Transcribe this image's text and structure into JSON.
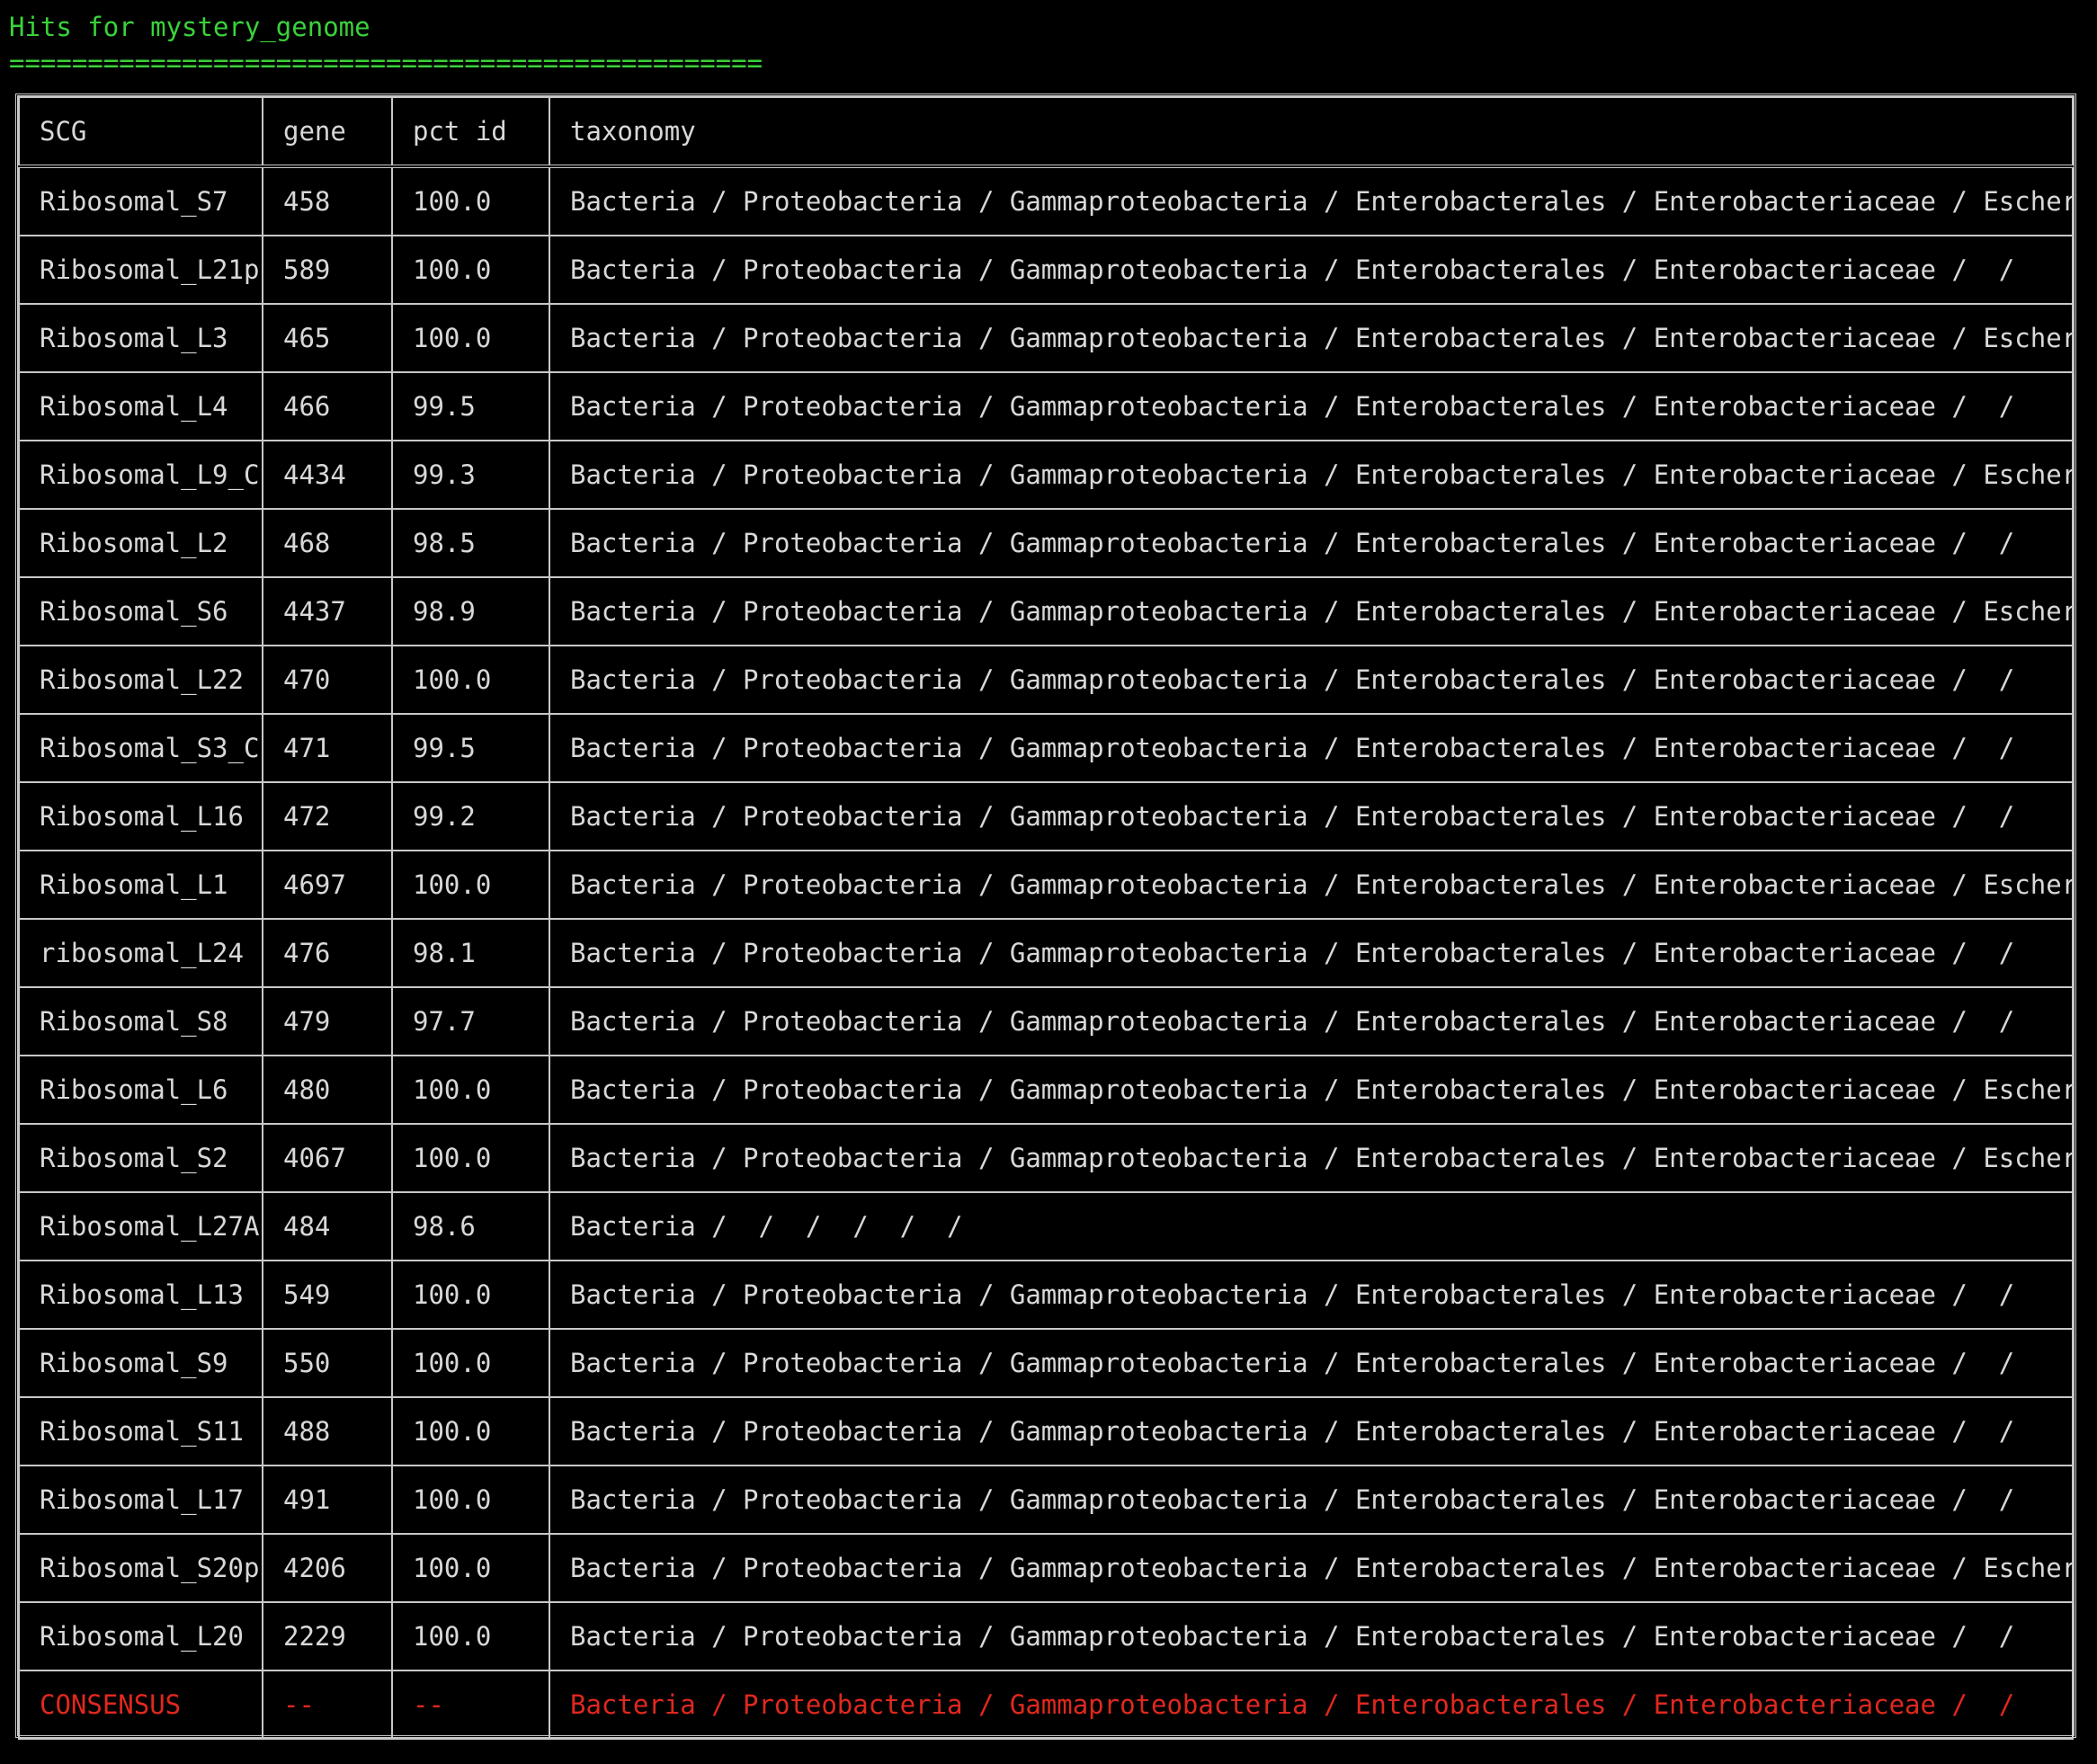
{
  "title": "Hits for mystery_genome",
  "rule": "================================================",
  "table": {
    "headers": [
      "SCG",
      "gene",
      "pct id",
      "taxonomy"
    ],
    "rows": [
      {
        "scg": "Ribosomal_S7",
        "gene": "458",
        "pct": "100.0",
        "taxonomy": "Bacteria / Proteobacteria / Gammaproteobacteria / Enterobacterales / Enterobacteriaceae / Escherichia /"
      },
      {
        "scg": "Ribosomal_L21p",
        "gene": "589",
        "pct": "100.0",
        "taxonomy": "Bacteria / Proteobacteria / Gammaproteobacteria / Enterobacterales / Enterobacteriaceae /  /"
      },
      {
        "scg": "Ribosomal_L3",
        "gene": "465",
        "pct": "100.0",
        "taxonomy": "Bacteria / Proteobacteria / Gammaproteobacteria / Enterobacterales / Enterobacteriaceae / Escherichia /"
      },
      {
        "scg": "Ribosomal_L4",
        "gene": "466",
        "pct": "99.5",
        "taxonomy": "Bacteria / Proteobacteria / Gammaproteobacteria / Enterobacterales / Enterobacteriaceae /  /"
      },
      {
        "scg": "Ribosomal_L9_C",
        "gene": "4434",
        "pct": "99.3",
        "taxonomy": "Bacteria / Proteobacteria / Gammaproteobacteria / Enterobacterales / Enterobacteriaceae / Escherichia /"
      },
      {
        "scg": "Ribosomal_L2",
        "gene": "468",
        "pct": "98.5",
        "taxonomy": "Bacteria / Proteobacteria / Gammaproteobacteria / Enterobacterales / Enterobacteriaceae /  /"
      },
      {
        "scg": "Ribosomal_S6",
        "gene": "4437",
        "pct": "98.9",
        "taxonomy": "Bacteria / Proteobacteria / Gammaproteobacteria / Enterobacterales / Enterobacteriaceae / Escherichia /"
      },
      {
        "scg": "Ribosomal_L22",
        "gene": "470",
        "pct": "100.0",
        "taxonomy": "Bacteria / Proteobacteria / Gammaproteobacteria / Enterobacterales / Enterobacteriaceae /  /"
      },
      {
        "scg": "Ribosomal_S3_C",
        "gene": "471",
        "pct": "99.5",
        "taxonomy": "Bacteria / Proteobacteria / Gammaproteobacteria / Enterobacterales / Enterobacteriaceae /  /"
      },
      {
        "scg": "Ribosomal_L16",
        "gene": "472",
        "pct": "99.2",
        "taxonomy": "Bacteria / Proteobacteria / Gammaproteobacteria / Enterobacterales / Enterobacteriaceae /  /"
      },
      {
        "scg": "Ribosomal_L1",
        "gene": "4697",
        "pct": "100.0",
        "taxonomy": "Bacteria / Proteobacteria / Gammaproteobacteria / Enterobacterales / Enterobacteriaceae / Escherichia /"
      },
      {
        "scg": "ribosomal_L24",
        "gene": "476",
        "pct": "98.1",
        "taxonomy": "Bacteria / Proteobacteria / Gammaproteobacteria / Enterobacterales / Enterobacteriaceae /  /"
      },
      {
        "scg": "Ribosomal_S8",
        "gene": "479",
        "pct": "97.7",
        "taxonomy": "Bacteria / Proteobacteria / Gammaproteobacteria / Enterobacterales / Enterobacteriaceae /  /"
      },
      {
        "scg": "Ribosomal_L6",
        "gene": "480",
        "pct": "100.0",
        "taxonomy": "Bacteria / Proteobacteria / Gammaproteobacteria / Enterobacterales / Enterobacteriaceae / Escherichia /"
      },
      {
        "scg": "Ribosomal_S2",
        "gene": "4067",
        "pct": "100.0",
        "taxonomy": "Bacteria / Proteobacteria / Gammaproteobacteria / Enterobacterales / Enterobacteriaceae / Escherichia /"
      },
      {
        "scg": "Ribosomal_L27A",
        "gene": "484",
        "pct": "98.6",
        "taxonomy": "Bacteria /  /  /  /  /  /"
      },
      {
        "scg": "Ribosomal_L13",
        "gene": "549",
        "pct": "100.0",
        "taxonomy": "Bacteria / Proteobacteria / Gammaproteobacteria / Enterobacterales / Enterobacteriaceae /  /"
      },
      {
        "scg": "Ribosomal_S9",
        "gene": "550",
        "pct": "100.0",
        "taxonomy": "Bacteria / Proteobacteria / Gammaproteobacteria / Enterobacterales / Enterobacteriaceae /  /"
      },
      {
        "scg": "Ribosomal_S11",
        "gene": "488",
        "pct": "100.0",
        "taxonomy": "Bacteria / Proteobacteria / Gammaproteobacteria / Enterobacterales / Enterobacteriaceae /  /"
      },
      {
        "scg": "Ribosomal_L17",
        "gene": "491",
        "pct": "100.0",
        "taxonomy": "Bacteria / Proteobacteria / Gammaproteobacteria / Enterobacterales / Enterobacteriaceae /  /"
      },
      {
        "scg": "Ribosomal_S20p",
        "gene": "4206",
        "pct": "100.0",
        "taxonomy": "Bacteria / Proteobacteria / Gammaproteobacteria / Enterobacterales / Enterobacteriaceae / Escherichia /"
      },
      {
        "scg": "Ribosomal_L20",
        "gene": "2229",
        "pct": "100.0",
        "taxonomy": "Bacteria / Proteobacteria / Gammaproteobacteria / Enterobacterales / Enterobacteriaceae /  /"
      }
    ],
    "consensus": {
      "scg": "CONSENSUS",
      "gene": "--",
      "pct": "--",
      "taxonomy": "Bacteria / Proteobacteria / Gammaproteobacteria / Enterobacterales / Enterobacteriaceae /  /"
    }
  },
  "colors": {
    "background": "#000000",
    "title_green": "#3ad23a",
    "text": "#d8d8d8",
    "consensus_red": "#e0281e",
    "border": "#c8c8c8"
  }
}
